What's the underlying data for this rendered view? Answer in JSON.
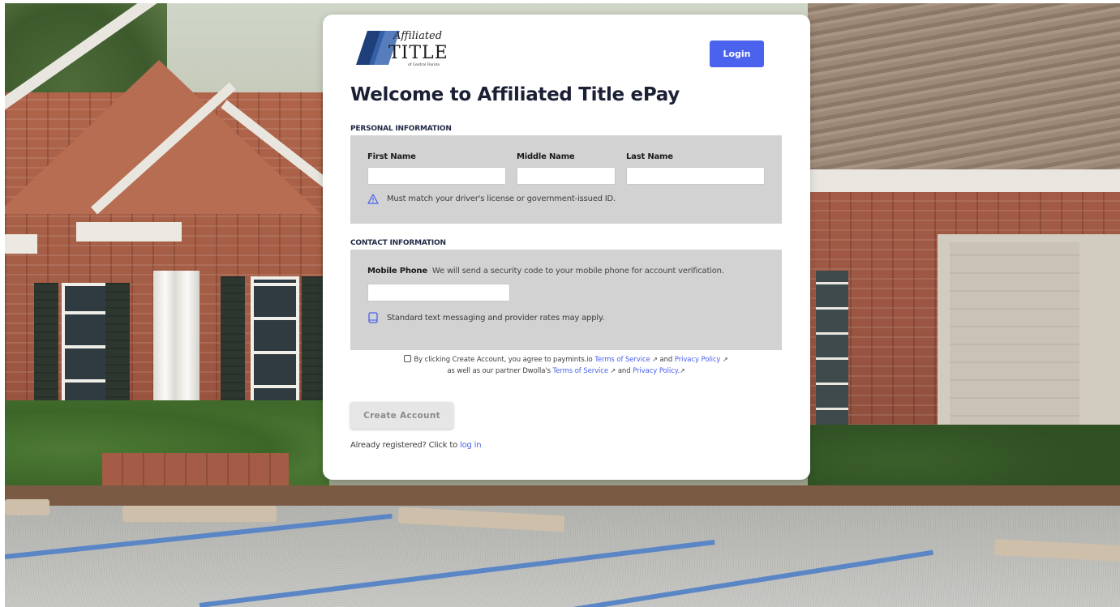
{
  "logo": {
    "script_text": "Affiliated",
    "main_text": "TITLE",
    "sub_text": "of Central Florida"
  },
  "header": {
    "login_label": "Login"
  },
  "page": {
    "title": "Welcome to Affiliated Title ePay"
  },
  "personal": {
    "section_label": "PERSONAL INFORMATION",
    "first_name_label": "First Name",
    "first_name_value": "",
    "middle_name_label": "Middle Name",
    "middle_name_value": "",
    "last_name_label": "Last Name",
    "last_name_value": "",
    "note": "Must match your driver's license or government-issued ID."
  },
  "contact": {
    "section_label": "CONTACT INFORMATION",
    "mobile_label": "Mobile Phone",
    "mobile_hint": "We will send a security code to your mobile phone for account verification.",
    "mobile_value": "",
    "note": "Standard text messaging and provider rates may apply."
  },
  "consent": {
    "line1_prefix": "By clicking Create Account, you agree to paymints.io",
    "tos1": "Terms of Service",
    "and1": "and",
    "privacy1": "Privacy Policy",
    "line2_prefix": "as well as our partner Dwolla's",
    "tos2": "Terms of Service",
    "and2": "and",
    "privacy2": "Privacy Policy."
  },
  "actions": {
    "create_account_label": "Create Account",
    "registered_prefix": "Already registered? Click to",
    "login_link": "log in"
  },
  "colors": {
    "accent": "#4a62ee",
    "panel": "#d2d2d2",
    "title": "#1b2035"
  },
  "icons": {
    "warning": "warning-triangle-icon",
    "phone": "phone-icon",
    "external": "external-link-icon",
    "checkbox": "checkbox-icon"
  }
}
